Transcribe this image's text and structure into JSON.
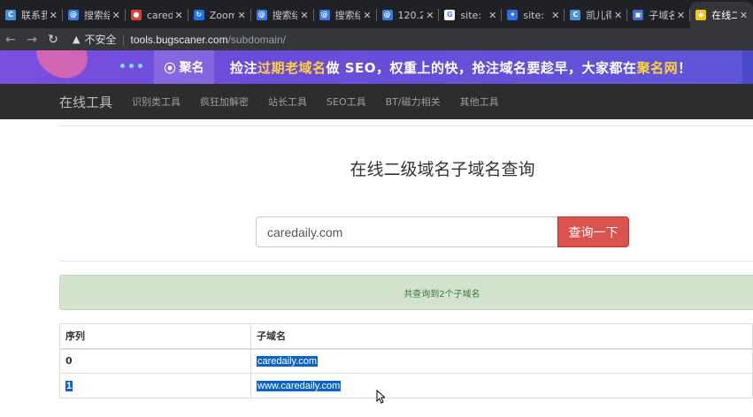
{
  "browser": {
    "tabs": [
      {
        "title": "联系我",
        "icon": "c-icon",
        "color": "#4a90d9",
        "glyph": "C"
      },
      {
        "title": "搜索结",
        "icon": "doc-search-icon",
        "color": "#3b78e7",
        "glyph": "@"
      },
      {
        "title": "caredaily",
        "icon": "care-icon",
        "color": "#e0403a",
        "glyph": "●"
      },
      {
        "title": "Zoom",
        "icon": "loading-icon",
        "color": "#1a73e8",
        "glyph": "↻"
      },
      {
        "title": "搜索结",
        "icon": "doc-search-icon",
        "color": "#3b78e7",
        "glyph": "@"
      },
      {
        "title": "搜索结",
        "icon": "doc-search-icon",
        "color": "#3b78e7",
        "glyph": "@"
      },
      {
        "title": "120.2",
        "icon": "doc-search-icon",
        "color": "#3b78e7",
        "glyph": "@"
      },
      {
        "title": "site:",
        "icon": "google-icon",
        "color": "#ffffff",
        "glyph": "G"
      },
      {
        "title": "site:",
        "icon": "baidu-icon",
        "color": "#2f6ee6",
        "glyph": "✦"
      },
      {
        "title": "凯儿得",
        "icon": "c-icon",
        "color": "#4a90d9",
        "glyph": "C"
      },
      {
        "title": "子域名",
        "icon": "tool-icon",
        "color": "#3b6fd6",
        "glyph": "▣"
      },
      {
        "title": "在线二",
        "icon": "python-icon",
        "color": "#f5c518",
        "glyph": "◆"
      }
    ],
    "nav_back": "←",
    "nav_forward": "→",
    "nav_reload": "C",
    "security_label": "不安全",
    "url_host": "tools.bugscaner.com",
    "url_path": "/subdomain/"
  },
  "banner": {
    "logo": "聚名",
    "slogan_parts": [
      "捡注",
      "过期老域名",
      "做 SEO，权重上的快，抢注域名要趁早，大家都在",
      "聚名网",
      "！"
    ]
  },
  "site_nav": {
    "brand": "在线工具",
    "items": [
      "识别类工具",
      "疯狂加解密",
      "站长工具",
      "SEO工具",
      "BT/磁力相关",
      "其他工具"
    ]
  },
  "main": {
    "title": "在线二级域名子域名查询",
    "search_value": "caredaily.com",
    "search_button": "查询一下",
    "result_summary": "共查询到2个子域名",
    "table": {
      "headers": [
        "序列",
        "子域名"
      ],
      "rows": [
        {
          "index": "0",
          "domain": "caredaily.com"
        },
        {
          "index": "1",
          "domain": "www.caredaily.com"
        }
      ]
    }
  }
}
